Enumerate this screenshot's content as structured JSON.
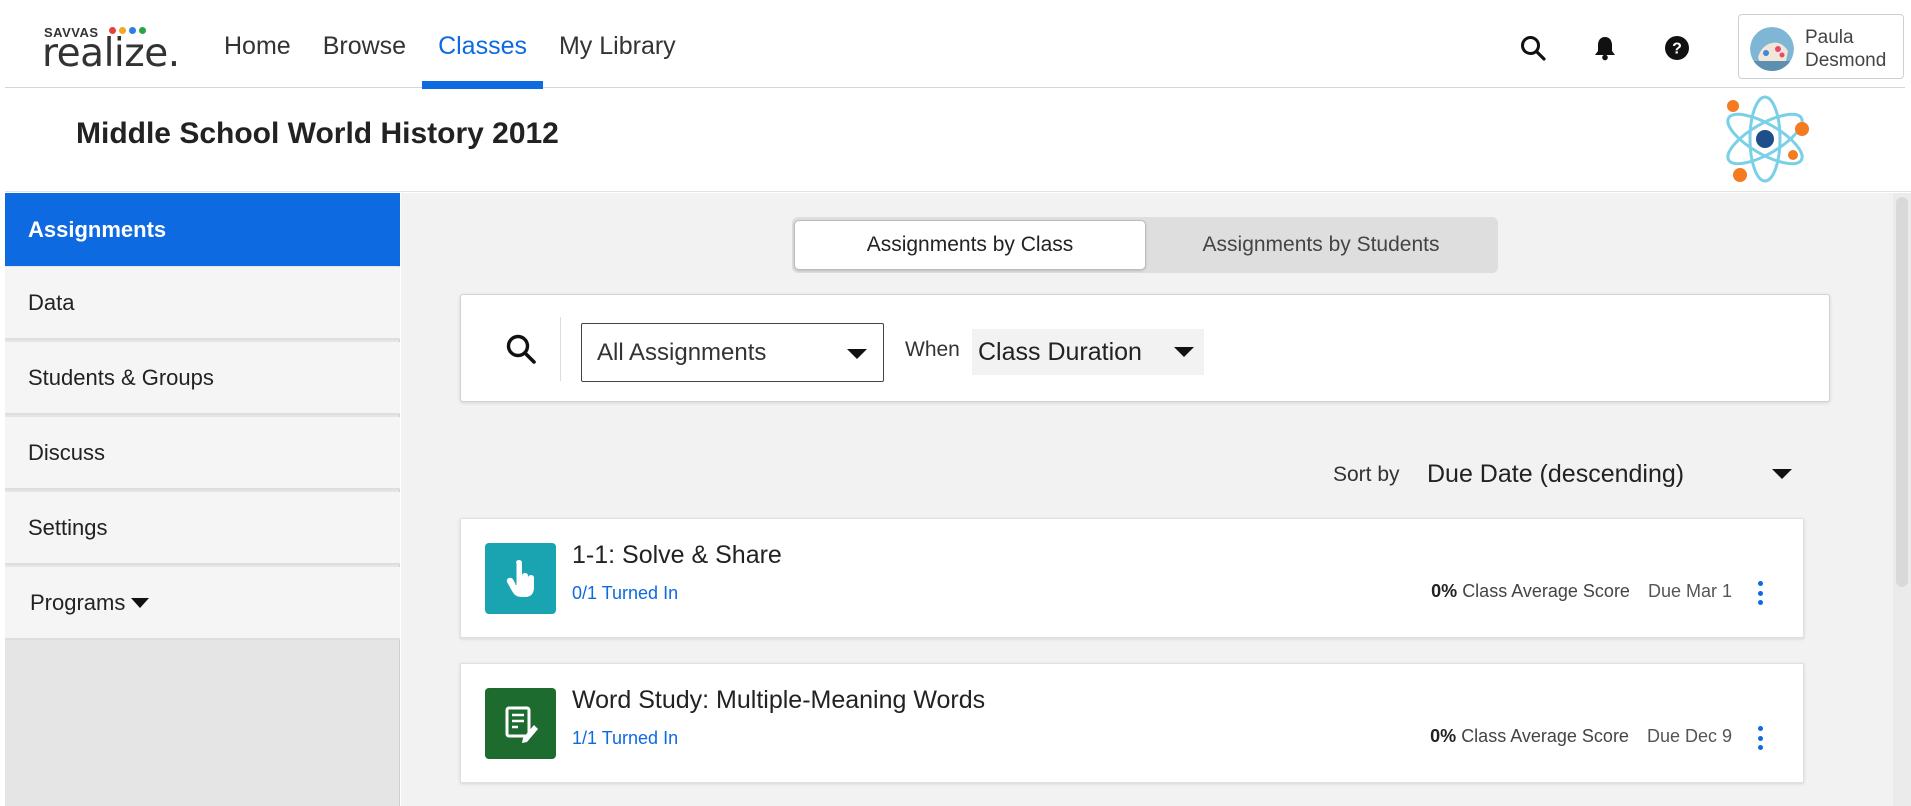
{
  "brand": {
    "savvas": "SAVVAS",
    "realize": "realize.",
    "dot_colors": [
      "#e8403a",
      "#f5a623",
      "#2b7de9",
      "#27a844"
    ]
  },
  "nav": {
    "links": [
      {
        "label": "Home"
      },
      {
        "label": "Browse"
      },
      {
        "label": "Classes",
        "active": true
      },
      {
        "label": "My Library"
      }
    ],
    "icons": [
      "search-icon",
      "bell-icon",
      "help-icon"
    ],
    "user": {
      "first": "Paula",
      "last": "Desmond"
    }
  },
  "class_header": {
    "title": "Middle School World History 2012",
    "image": "atom-icon"
  },
  "sidebar": {
    "items": [
      {
        "label": "Assignments",
        "active": true
      },
      {
        "label": "Data"
      },
      {
        "label": "Students & Groups"
      },
      {
        "label": "Discuss"
      },
      {
        "label": "Settings"
      },
      {
        "label": "Programs"
      }
    ]
  },
  "toggle": {
    "by_class": "Assignments by Class",
    "by_students": "Assignments by Students",
    "active": "by_class"
  },
  "filters": {
    "assignment_type": "All Assignments",
    "when_label": "When",
    "when_value": "Class Duration"
  },
  "sort": {
    "label": "Sort by",
    "value": "Due Date (descending)"
  },
  "assignments": [
    {
      "title": "1-1: Solve & Share",
      "turned_in": "0/1 Turned In",
      "avg_pct": "0%",
      "avg_label": "Class Average Score",
      "due": "Due Mar 1",
      "icon": "hand-pointer-icon",
      "icon_color": "#1aa3b0"
    },
    {
      "title": "Word Study: Multiple-Meaning Words",
      "turned_in": "1/1 Turned In",
      "avg_pct": "0%",
      "avg_label": "Class Average Score",
      "due": "Due Dec 9",
      "icon": "document-edit-icon",
      "icon_color": "#1d6b2e"
    }
  ],
  "colors": {
    "accent": "#0d6ae0"
  }
}
